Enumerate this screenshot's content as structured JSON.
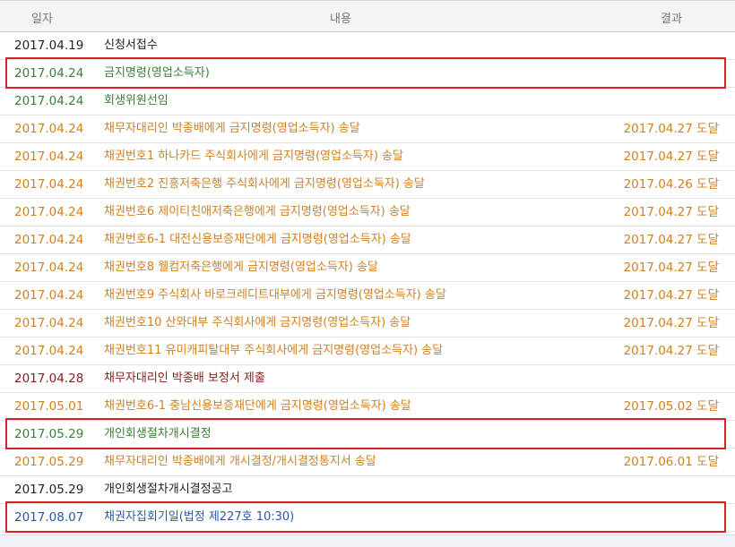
{
  "header": {
    "date": "일자",
    "content": "내용",
    "result": "결과"
  },
  "rows": [
    {
      "date": "2017.04.19",
      "content": "신청서접수",
      "result": "",
      "color": "black"
    },
    {
      "date": "2017.04.24",
      "content": "금지명령(영업소득자)",
      "result": "",
      "color": "green"
    },
    {
      "date": "2017.04.24",
      "content": "회생위원선임",
      "result": "",
      "color": "green"
    },
    {
      "date": "2017.04.24",
      "content": "채무자대리인 박종배에게 금지명령(영업소득자) 송달",
      "result": "2017.04.27 도달",
      "color": "orange"
    },
    {
      "date": "2017.04.24",
      "content": "채권번호1 하나카드 주식회사에게 금지명령(영업소득자) 송달",
      "result": "2017.04.27 도달",
      "color": "orange"
    },
    {
      "date": "2017.04.24",
      "content": "채권번호2 진흥저축은행 주식회사에게 금지명령(영업소득자) 송달",
      "result": "2017.04.26 도달",
      "color": "orange"
    },
    {
      "date": "2017.04.24",
      "content": "채권번호6 제이티친애저축은행에게 금지명령(영업소득자) 송달",
      "result": "2017.04.27 도달",
      "color": "orange"
    },
    {
      "date": "2017.04.24",
      "content": "채권번호6-1 대전신용보증재단에게 금지명령(영업소득자) 송달",
      "result": "2017.04.27 도달",
      "color": "orange"
    },
    {
      "date": "2017.04.24",
      "content": "채권번호8 웰컴저축은행에게 금지명령(영업소득자) 송달",
      "result": "2017.04.27 도달",
      "color": "orange"
    },
    {
      "date": "2017.04.24",
      "content": "채권번호9 주식회사 바로크레디트대부에게 금지명령(영업소득자) 송달",
      "result": "2017.04.27 도달",
      "color": "orange"
    },
    {
      "date": "2017.04.24",
      "content": "채권번호10 산와대부 주식회사에게 금지명령(영업소득자) 송달",
      "result": "2017.04.27 도달",
      "color": "orange"
    },
    {
      "date": "2017.04.24",
      "content": "채권번호11 유미캐피탈대부 주식회사에게 금지명령(영업소득자) 송달",
      "result": "2017.04.27 도달",
      "color": "orange"
    },
    {
      "date": "2017.04.28",
      "content": "채무자대리인 박종배 보정서 제출",
      "result": "",
      "color": "maroon"
    },
    {
      "date": "2017.05.01",
      "content": "채권번호6-1 충남신용보증재단에게 금지명령(영업소득자) 송달",
      "result": "2017.05.02 도달",
      "color": "orange"
    },
    {
      "date": "2017.05.29",
      "content": "개인회생절차개시결정",
      "result": "",
      "color": "green"
    },
    {
      "date": "2017.05.29",
      "content": "채무자대리인 박종배에게 개시결정/개시결정통지서 송달",
      "result": "2017.06.01 도달",
      "color": "orange"
    },
    {
      "date": "2017.05.29",
      "content": "개인회생절차개시결정공고",
      "result": "",
      "color": "black"
    },
    {
      "date": "2017.08.07",
      "content": "채권자집회기일(법정 제227호 10:30)",
      "result": "",
      "color": "blue"
    }
  ],
  "colors": {
    "black": "#222222",
    "green": "#3a7d3a",
    "orange": "#d1801f",
    "maroon": "#8a1c1c",
    "blue": "#2a56a8",
    "highlight": "#d6202a"
  },
  "highlighted_rows": [
    1,
    14,
    17
  ]
}
